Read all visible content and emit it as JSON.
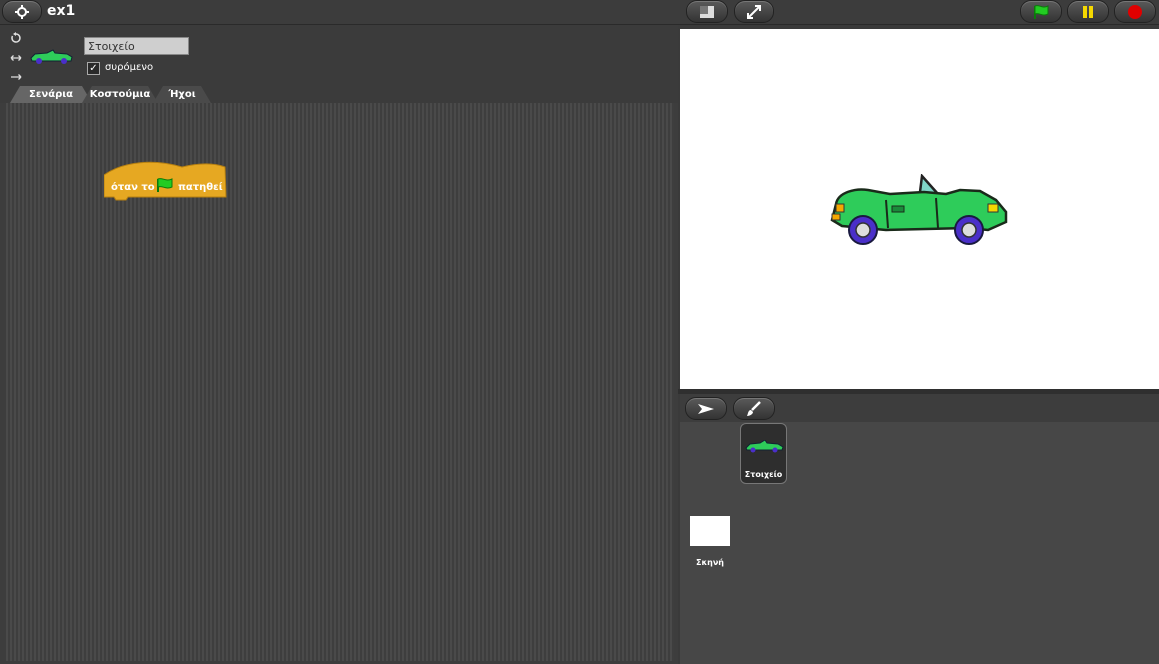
{
  "project": {
    "title": "ex1"
  },
  "sprite": {
    "name": "Στοιχείο",
    "draggable_label": "συρόμενο",
    "draggable_checked": "✓"
  },
  "tabs": [
    {
      "label": "Σενάρια",
      "active": true
    },
    {
      "label": "Κοστούμια",
      "active": false
    },
    {
      "label": "Ήχοι",
      "active": false
    }
  ],
  "scripts": {
    "hat_block": {
      "text_before": "όταν το",
      "text_after": "πατηθεί",
      "icon": "green-flag-icon",
      "color": "#e6a822"
    }
  },
  "corral": {
    "sprites": [
      {
        "name": "Στοιχείο"
      }
    ],
    "stage_label": "Σκηνή"
  },
  "colors": {
    "car_body": "#2ecc5a",
    "wheel": "#4a2fc9",
    "flag_green": "#22cc22",
    "pause_yellow": "#f5d800",
    "stop_red": "#e00000"
  },
  "icons": [
    "settings-icon",
    "stage-layout-icon",
    "fullscreen-icon",
    "green-flag-icon",
    "pause-icon",
    "stop-icon",
    "rotate-full-icon",
    "rotate-leftright-icon",
    "no-rotate-icon",
    "arrow-tool-icon",
    "paintbrush-icon"
  ]
}
